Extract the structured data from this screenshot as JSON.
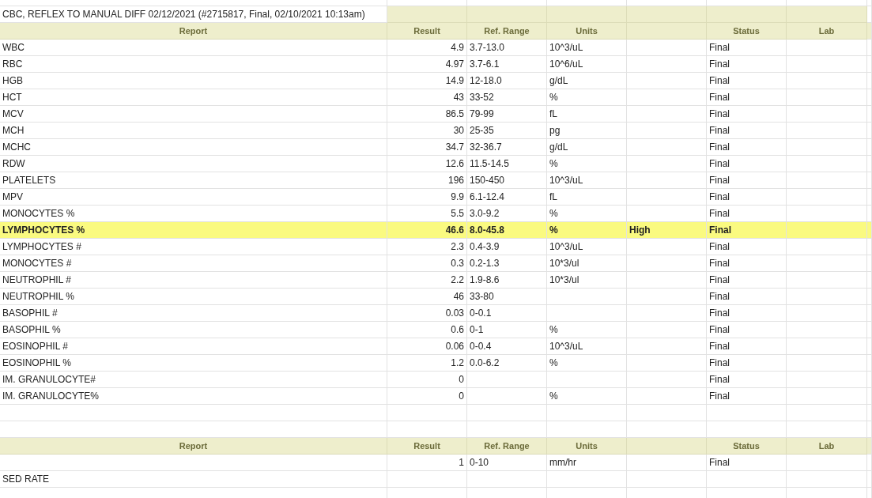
{
  "sections": [
    {
      "title": "CBC, REFLEX TO MANUAL DIFF 02/12/2021 (#2715817, Final, 02/10/2021 10:13am)",
      "header": {
        "report": "Report",
        "result": "Result",
        "ref_range": "Ref. Range",
        "units": "Units",
        "status": "Status",
        "lab": "Lab"
      },
      "rows": [
        {
          "report": "WBC",
          "result": "4.9",
          "ref_range": "3.7-13.0",
          "units": "10^3/uL",
          "status": "Final",
          "abnormal": false
        },
        {
          "report": "RBC",
          "result": "4.97",
          "ref_range": "3.7-6.1",
          "units": "10^6/uL",
          "status": "Final",
          "abnormal": false
        },
        {
          "report": "HGB",
          "result": "14.9",
          "ref_range": "12-18.0",
          "units": "g/dL",
          "status": "Final",
          "abnormal": false
        },
        {
          "report": "HCT",
          "result": "43",
          "ref_range": "33-52",
          "units": "%",
          "status": "Final",
          "abnormal": false
        },
        {
          "report": "MCV",
          "result": "86.5",
          "ref_range": "79-99",
          "units": "fL",
          "status": "Final",
          "abnormal": false
        },
        {
          "report": "MCH",
          "result": "30",
          "ref_range": "25-35",
          "units": "pg",
          "status": "Final",
          "abnormal": false
        },
        {
          "report": "MCHC",
          "result": "34.7",
          "ref_range": "32-36.7",
          "units": "g/dL",
          "status": "Final",
          "abnormal": false
        },
        {
          "report": "RDW",
          "result": "12.6",
          "ref_range": "11.5-14.5",
          "units": "%",
          "status": "Final",
          "abnormal": false
        },
        {
          "report": "PLATELETS",
          "result": "196",
          "ref_range": "150-450",
          "units": "10^3/uL",
          "status": "Final",
          "abnormal": false
        },
        {
          "report": "MPV",
          "result": "9.9",
          "ref_range": "6.1-12.4",
          "units": "fL",
          "status": "Final",
          "abnormal": false
        },
        {
          "report": "MONOCYTES %",
          "result": "5.5",
          "ref_range": "3.0-9.2",
          "units": "%",
          "status": "Final",
          "abnormal": false
        },
        {
          "report": "LYMPHOCYTES %",
          "result": "46.6",
          "ref_range": "8.0-45.8",
          "units": "%",
          "flag": "High",
          "status": "Final",
          "abnormal": true
        },
        {
          "report": "LYMPHOCYTES #",
          "result": "2.3",
          "ref_range": "0.4-3.9",
          "units": "10^3/uL",
          "status": "Final",
          "abnormal": false
        },
        {
          "report": "MONOCYTES #",
          "result": "0.3",
          "ref_range": "0.2-1.3",
          "units": "10*3/ul",
          "status": "Final",
          "abnormal": false
        },
        {
          "report": "NEUTROPHIL #",
          "result": "2.2",
          "ref_range": "1.9-8.6",
          "units": "10*3/ul",
          "status": "Final",
          "abnormal": false
        },
        {
          "report": "NEUTROPHIL %",
          "result": "46",
          "ref_range": "33-80",
          "status": "Final",
          "abnormal": false
        },
        {
          "report": "BASOPHIL #",
          "result": "0.03",
          "ref_range": "0-0.1",
          "status": "Final",
          "abnormal": false
        },
        {
          "report": "BASOPHIL %",
          "result": "0.6",
          "ref_range": "0-1",
          "units": "%",
          "status": "Final",
          "abnormal": false
        },
        {
          "report": "EOSINOPHIL #",
          "result": "0.06",
          "ref_range": "0-0.4",
          "units": "10^3/uL",
          "status": "Final",
          "abnormal": false
        },
        {
          "report": "EOSINOPHIL %",
          "result": "1.2",
          "ref_range": "0.0-6.2",
          "units": "%",
          "status": "Final",
          "abnormal": false
        },
        {
          "report": "IM. GRANULOCYTE#",
          "result": "0",
          "status": "Final",
          "abnormal": false
        },
        {
          "report": "IM. GRANULOCYTE%",
          "result": "0",
          "units": "%",
          "status": "Final",
          "abnormal": false
        }
      ]
    },
    {
      "header": {
        "report": "Report",
        "result": "Result",
        "ref_range": "Ref. Range",
        "units": "Units",
        "status": "Status",
        "lab": "Lab"
      },
      "rows": [
        {
          "result": "1",
          "ref_range": "0-10",
          "units": "mm/hr",
          "status": "Final",
          "abnormal": false
        },
        {
          "report": "SED RATE",
          "abnormal": false
        }
      ]
    }
  ]
}
